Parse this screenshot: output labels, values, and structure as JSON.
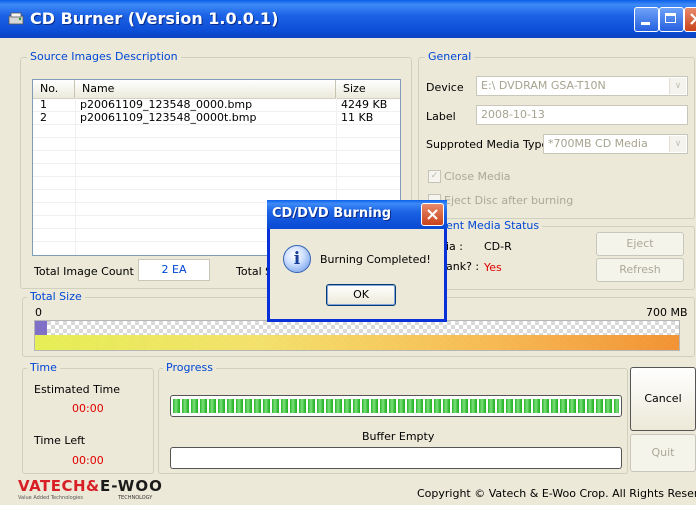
{
  "window": {
    "title": "CD Burner (Version 1.0.0.1)",
    "icon": "cd-burner-app-icon"
  },
  "source_images": {
    "legend": "Source Images Description",
    "columns": [
      "No.",
      "Name",
      "Size"
    ],
    "rows": [
      {
        "no": "1",
        "name": "p20061109_123548_0000.bmp",
        "size": "4249 KB"
      },
      {
        "no": "2",
        "name": "p20061109_123548_0000t.bmp",
        "size": "11 KB"
      }
    ],
    "total_count_label": "Total Image Count :",
    "total_count_value": "2 EA",
    "total_size_label_partial": "Total S"
  },
  "general": {
    "legend": "General",
    "device_label": "Device",
    "device_value": "E:\\ DVDRAM GSA-T10N",
    "label_label": "Label",
    "label_value": "2008-10-13",
    "media_type_label": "Supproted Media Type",
    "media_type_value": "*700MB CD Media",
    "close_media_label": "Close Media",
    "close_media_checked": true,
    "eject_label": "Eject Disc after burning",
    "eject_checked": false
  },
  "media_status": {
    "legend_partial": "ent Media Status",
    "media_label_partial": "ia :",
    "media_value": "CD-R",
    "blank_label_partial": "ank? :",
    "blank_value": "Yes",
    "eject_button": "Eject",
    "refresh_button": "Refresh"
  },
  "total_size": {
    "legend": "Total Size",
    "min_label": "0",
    "max_label": "700 MB",
    "used_fraction": 0.018
  },
  "time": {
    "legend": "Time",
    "estimated_label": "Estimated Time",
    "estimated_value": "00:00",
    "left_label": "Time Left",
    "left_value": "00:00"
  },
  "progress": {
    "legend": "Progress",
    "progress_fraction": 1.0,
    "buffer_label": "Buffer Empty",
    "buffer_fraction": 0.0
  },
  "buttons": {
    "cancel": "Cancel",
    "quit": "Quit"
  },
  "footer": {
    "logo_text": "VATECH&E-WOO",
    "logo_sub_left": "Value Added Technologies",
    "logo_sub_right": "TECHNOLOGY",
    "copyright": "Copyright © Vatech & E-Woo Crop. All Rights Reserved."
  },
  "dialog": {
    "title": "CD/DVD Burning",
    "message": "Burning Completed!",
    "ok_button": "OK",
    "icon": "info-icon"
  },
  "colors": {
    "titlebar": "#0b4cd4",
    "legend_text": "#0046d5",
    "progress_green": "#29b62a",
    "status_red": "#e00000"
  }
}
